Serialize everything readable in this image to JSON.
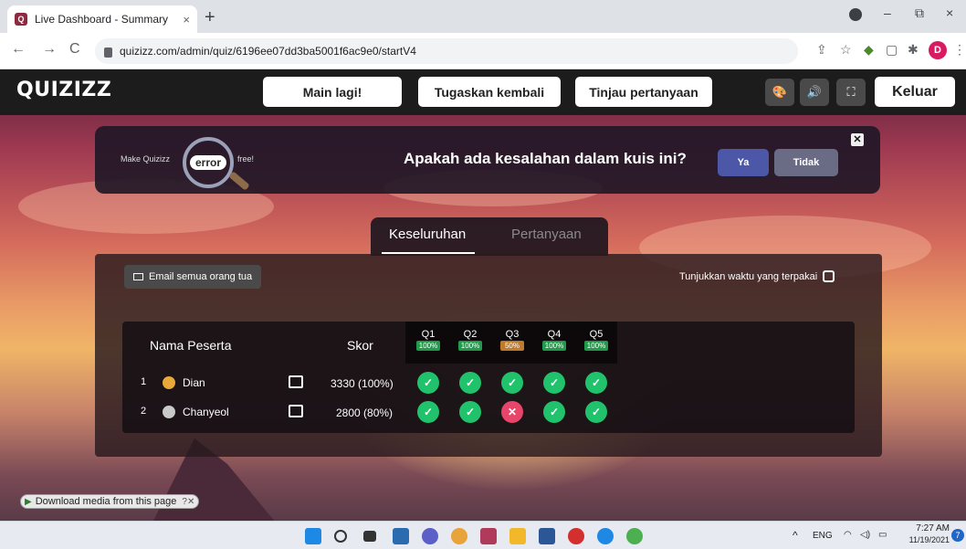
{
  "browser": {
    "tab_title": "Live Dashboard - Summary",
    "tab_close": "×",
    "new_tab": "+",
    "url": "quizizz.com/admin/quiz/6196ee07dd3ba5001f6ac9e0/startV4",
    "profile_initial": "D",
    "nav_back": "←",
    "nav_forward": "→",
    "nav_reload": "C",
    "win_min": "–",
    "win_restore": "⧉",
    "win_close": "×"
  },
  "app": {
    "logo": "QUIZIZZ",
    "nav": {
      "main_lagi": "Main lagi!",
      "tugaskan_kembali": "Tugaskan kembali",
      "tinjau_pertanyaan": "Tinjau pertanyaan",
      "keluar": "Keluar"
    },
    "banner": {
      "make_quizizz": "Make Quizizz",
      "error_word": "error",
      "free": "free!",
      "question": "Apakah ada kesalahan dalam kuis ini?",
      "yes": "Ya",
      "no": "Tidak",
      "close": "✕"
    },
    "tabs": [
      "Keseluruhan",
      "Pertanyaan"
    ],
    "email_all_parents": "Email semua orang tua",
    "show_time_used": "Tunjukkan waktu yang terpakai",
    "table": {
      "col_name": "Nama Peserta",
      "col_score": "Skor",
      "questions": [
        {
          "label": "Q1",
          "pct": "100%"
        },
        {
          "label": "Q2",
          "pct": "100%"
        },
        {
          "label": "Q3",
          "pct": "50%"
        },
        {
          "label": "Q4",
          "pct": "100%"
        },
        {
          "label": "Q5",
          "pct": "100%"
        }
      ],
      "rows": [
        {
          "rank": "1",
          "name": "Dian",
          "score": "3330 (100%)",
          "answers": [
            "correct",
            "correct",
            "correct",
            "correct",
            "correct"
          ]
        },
        {
          "rank": "2",
          "name": "Chanyeol",
          "score": "2800 (80%)",
          "answers": [
            "correct",
            "correct",
            "incorrect",
            "correct",
            "correct"
          ]
        }
      ]
    },
    "download_media": "Download media from this page",
    "download_extra": "?✕"
  },
  "taskbar": {
    "tray_caret": "^",
    "lang": "ENG",
    "time": "7:27 AM",
    "date": "11/19/2021",
    "notifications": "7"
  },
  "colors": {
    "correct": "#20c26b",
    "incorrect": "#e8456a",
    "topnav": "#1c1c1c",
    "banner_yes": "#4c57a7"
  }
}
